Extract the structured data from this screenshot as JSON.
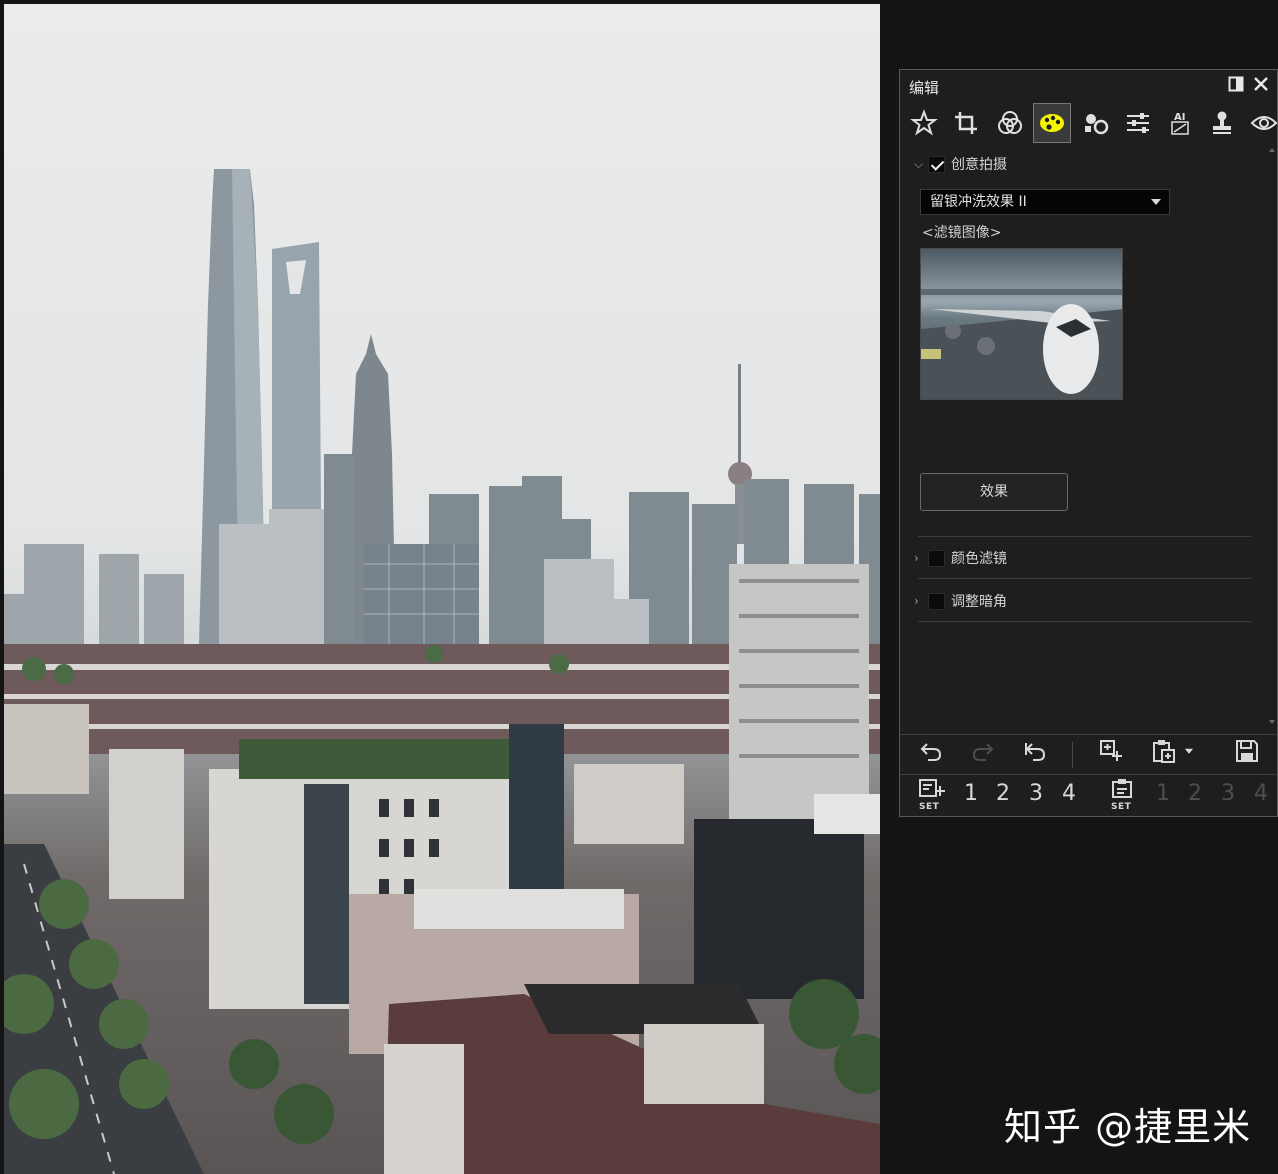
{
  "photo": {
    "description_icon": "city-skyline-photo"
  },
  "panel": {
    "title": "编辑",
    "dock_icon": "dock-icon",
    "close_icon": "close-icon",
    "tools": [
      "star-icon",
      "crop-icon",
      "color-circles-icon",
      "creative-palette-icon",
      "camera-settings-icon",
      "adjust-sliders-icon",
      "ai-icon",
      "stamp-icon",
      "eye-icon"
    ],
    "creative": {
      "label": "创意拍摄",
      "checked": true,
      "preset": "留银冲洗效果 II",
      "filter_image_label": "<滤镜图像>",
      "effect_button": "效果"
    },
    "color_filter": {
      "label": "颜色滤镜",
      "checked": false
    },
    "vignette": {
      "label": "调整暗角",
      "checked": false
    },
    "toolbar_row1": [
      "undo-icon",
      "redo-icon",
      "reset-icon",
      "copy-settings-icon",
      "paste-settings-icon",
      "paste-dropdown-icon",
      "save-icon"
    ],
    "set_row": {
      "save_set_icon": "save-set-icon",
      "save_slots": [
        "1",
        "2",
        "3",
        "4"
      ],
      "load_set_icon": "load-set-icon",
      "load_slots": [
        "1",
        "2",
        "3",
        "4"
      ],
      "set_label": "SET"
    }
  },
  "watermark": "知乎 @捷里米",
  "colors": {
    "accent_active": "#f5f500",
    "panel_bg": "#1e1e1e",
    "app_bg": "#141414"
  }
}
